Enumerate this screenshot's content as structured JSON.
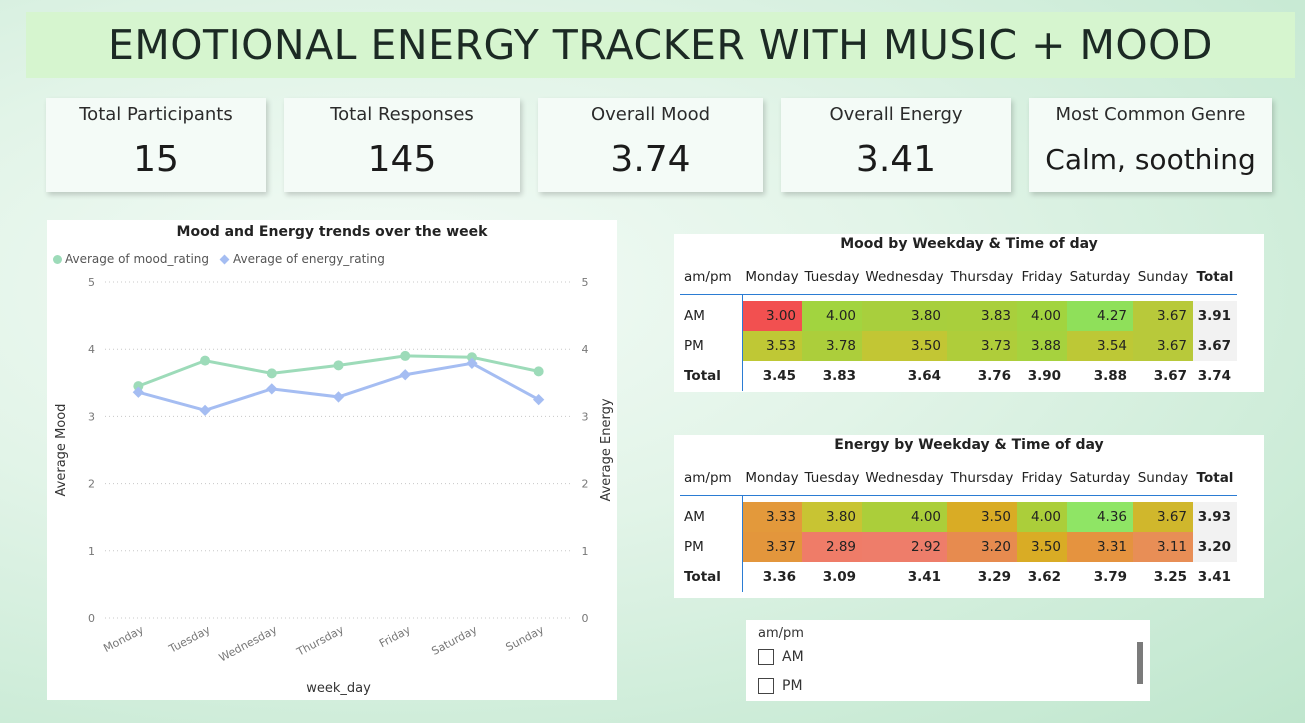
{
  "title": "EMOTIONAL ENERGY TRACKER WITH MUSIC + MOOD",
  "kpis": [
    {
      "label": "Total Participants",
      "value": "15"
    },
    {
      "label": "Total Responses",
      "value": "145"
    },
    {
      "label": "Overall Mood",
      "value": "3.74"
    },
    {
      "label": "Overall Energy",
      "value": "3.41"
    },
    {
      "label": "Most Common Genre",
      "value": "Calm, soothing"
    }
  ],
  "chart_data": {
    "type": "line",
    "title": "Mood and Energy trends over the week",
    "categories": [
      "Monday",
      "Tuesday",
      "Wednesday",
      "Thursday",
      "Friday",
      "Saturday",
      "Sunday"
    ],
    "series": [
      {
        "name": "Average of mood_rating",
        "values": [
          3.45,
          3.83,
          3.64,
          3.76,
          3.9,
          3.88,
          3.67
        ],
        "color": "#9ddbb9",
        "axis": "left"
      },
      {
        "name": "Average of energy_rating",
        "values": [
          3.36,
          3.09,
          3.41,
          3.29,
          3.62,
          3.79,
          3.25
        ],
        "color": "#a5bdf2",
        "axis": "right"
      }
    ],
    "xlabel": "week_day",
    "ylabel": "Average Mood",
    "y2label": "Average Energy",
    "ylim": [
      0,
      5
    ],
    "yticks": [
      "0",
      "1",
      "2",
      "3",
      "4",
      "5"
    ],
    "grid": true,
    "legend": "top-left"
  },
  "mood_matrix": {
    "title": "Mood by Weekday & Time of day",
    "row_header": "am/pm",
    "columns": [
      "Monday",
      "Tuesday",
      "Wednesday",
      "Thursday",
      "Friday",
      "Saturday",
      "Sunday"
    ],
    "total_label": "Total",
    "rows": [
      {
        "label": "AM",
        "values": [
          "3.00",
          "4.00",
          "3.80",
          "3.83",
          "4.00",
          "4.27",
          "3.67"
        ],
        "colors": [
          "#f25050",
          "#a2d43f",
          "#a8cf3d",
          "#a9cf3c",
          "#a2d43f",
          "#8fe05a",
          "#b8c93a"
        ],
        "total": "3.91"
      },
      {
        "label": "PM",
        "values": [
          "3.53",
          "3.78",
          "3.50",
          "3.73",
          "3.88",
          "3.54",
          "3.67"
        ],
        "colors": [
          "#bfc835",
          "#acce3b",
          "#c2c634",
          "#afcd3a",
          "#a6d23e",
          "#bdc836",
          "#b8c93a"
        ],
        "total": "3.67"
      }
    ],
    "totals": [
      "3.45",
      "3.83",
      "3.64",
      "3.76",
      "3.90",
      "3.88",
      "3.67"
    ],
    "grand_total": "3.74"
  },
  "energy_matrix": {
    "title": "Energy by Weekday & Time of day",
    "row_header": "am/pm",
    "columns": [
      "Monday",
      "Tuesday",
      "Wednesday",
      "Thursday",
      "Friday",
      "Saturday",
      "Sunday"
    ],
    "total_label": "Total",
    "rows": [
      {
        "label": "AM",
        "values": [
          "3.33",
          "3.80",
          "4.00",
          "3.50",
          "4.00",
          "4.36",
          "3.67"
        ],
        "colors": [
          "#e3993b",
          "#c8c433",
          "#abce3a",
          "#d9ac25",
          "#abce3a",
          "#8fe565",
          "#d0b72c"
        ],
        "total": "3.93"
      },
      {
        "label": "PM",
        "values": [
          "3.37",
          "2.89",
          "2.92",
          "3.20",
          "3.50",
          "3.31",
          "3.11"
        ],
        "colors": [
          "#e3963c",
          "#ef7c68",
          "#ee7d6a",
          "#e78b4f",
          "#d9ac25",
          "#e5933f",
          "#e88e56"
        ],
        "total": "3.20"
      }
    ],
    "totals": [
      "3.36",
      "3.09",
      "3.41",
      "3.29",
      "3.62",
      "3.79",
      "3.25"
    ],
    "grand_total": "3.41"
  },
  "slicer": {
    "header": "am/pm",
    "options": [
      "AM",
      "PM"
    ]
  }
}
